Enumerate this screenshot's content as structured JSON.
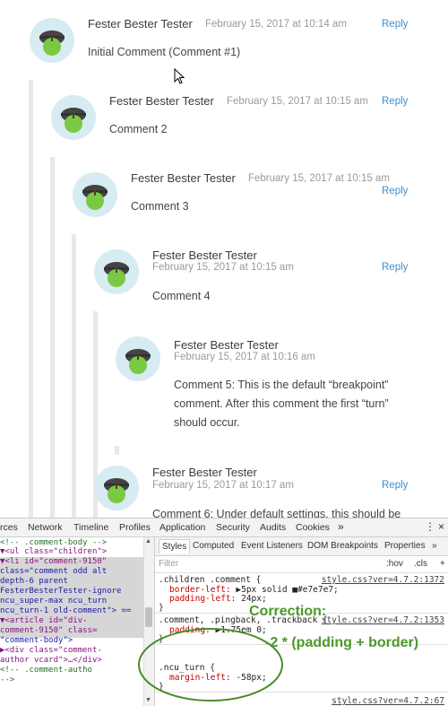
{
  "comments": [
    {
      "author": "Fester Bester Tester",
      "date": "February 15, 2017 at 10:14 am",
      "reply": "Reply",
      "body": "Initial Comment (Comment #1)"
    },
    {
      "author": "Fester Bester Tester",
      "date": "February 15, 2017 at 10:15 am",
      "reply": "Reply",
      "body": "Comment 2"
    },
    {
      "author": "Fester Bester Tester",
      "date": "February 15, 2017 at 10:15 am",
      "reply": "Reply",
      "body": "Comment 3"
    },
    {
      "author": "Fester Bester Tester",
      "date": "February 15, 2017 at 10:15 am",
      "reply": "Reply",
      "body": "Comment 4"
    },
    {
      "author": "Fester Bester Tester",
      "date": "February 15, 2017 at 10:16 am",
      "reply": "",
      "body_lines": [
        "Comment 5: This is the default “breakpoint”",
        "comment. After this comment the first “turn”",
        "should occur."
      ]
    },
    {
      "author": "Fester Bester Tester",
      "date": "February 15, 2017 at 10:17 am",
      "reply": "Reply",
      "body": "Comment 6: Under default settings, this should be"
    }
  ],
  "devtools": {
    "tabs": [
      "rces",
      "Network",
      "Timeline",
      "Profiles",
      "Application",
      "Security",
      "Audits",
      "Cookies",
      "»"
    ],
    "elements_lines": [
      "<!-- .comment-body -->",
      "▼<ul class=\"children\">",
      " ▼<li id=\"comment-9150\"",
      "  class=\"comment odd alt",
      "  depth-6 parent",
      "  FesterBesterTester-ignore",
      "  ncu_super-max ncu_turn",
      "  ncu_turn-1 old-comment\"> ==",
      "   ▼<article id=\"div-",
      "    comment-9150\" class=",
      "    \"comment-body\">",
      "     ▶<div class=\"comment-",
      "      author vcard\">…</div>",
      "      <!-- .comment-autho",
      "      -->"
    ],
    "styles_tabs": [
      "Styles",
      "Computed",
      "Event Listeners",
      "DOM Breakpoints",
      "Properties",
      "»"
    ],
    "filter_placeholder": "Filter",
    "filter_hov": ":hov",
    "filter_cls": ".cls",
    "filter_plus": "+",
    "rules": [
      {
        "selector": ".children .comment {",
        "link": "style.css?ver=4.7.2:1372",
        "props": [
          {
            "name": "border-left:",
            "value": "▶5px solid ■#e7e7e7;"
          },
          {
            "name": "padding-left:",
            "value": "24px;"
          }
        ]
      },
      {
        "selector": ".comment, .pingback, .trackback {",
        "link": "style.css?ver=4.7.2:1353",
        "props": [
          {
            "name": "padding:",
            "value": "▶1.75em 0;"
          }
        ]
      },
      {
        "selector": ".ncu_turn {",
        "link": "",
        "props": [
          {
            "name": "margin-left:",
            "value": "-58px;"
          }
        ]
      }
    ],
    "last_link": "style.css?ver=4.7.2:67"
  },
  "annotation": {
    "line1": "Correction:",
    "line2": "-2 * (padding + border)"
  }
}
